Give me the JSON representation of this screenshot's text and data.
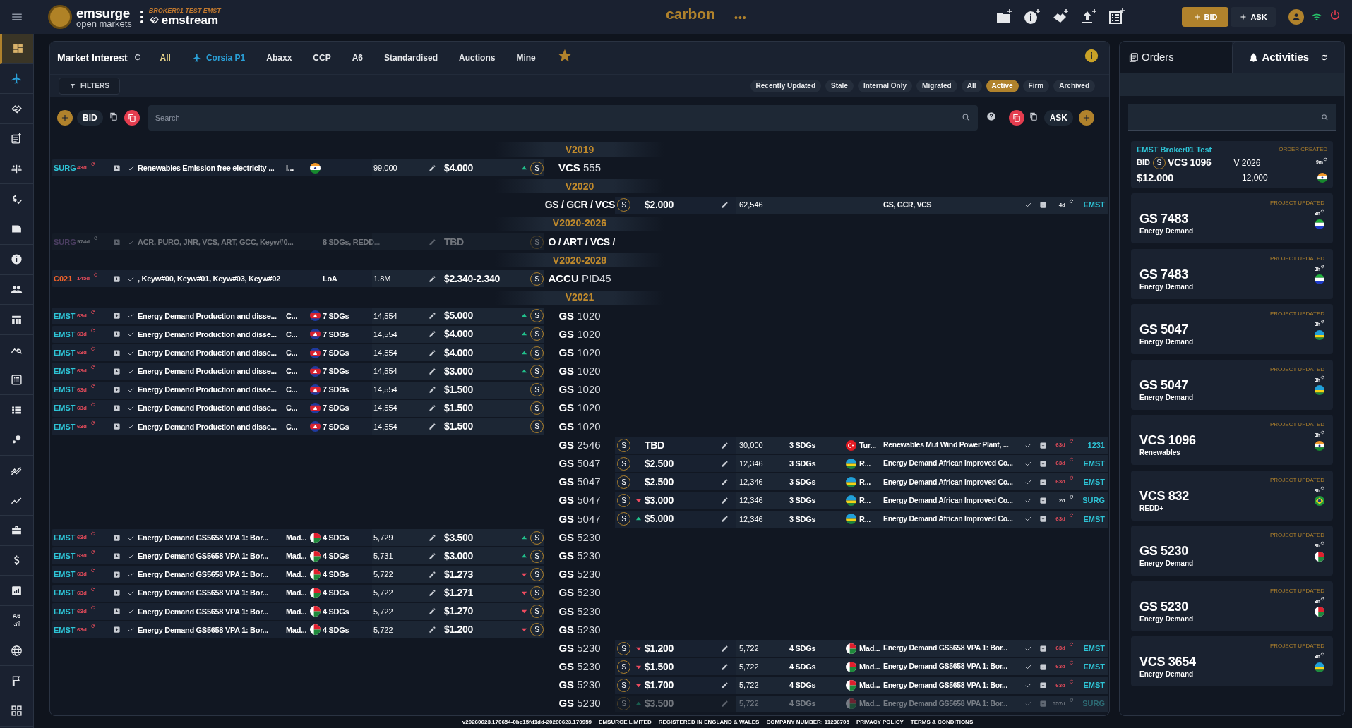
{
  "header": {
    "brand": "emsurge",
    "brand_sub": "open markets",
    "account": "BROKER01 TEST EMST",
    "product": "emstream",
    "market": "carbon",
    "more": "•••",
    "bid_button": "BID",
    "ask_button": "ASK"
  },
  "sidebar": {
    "items": [
      {
        "selected": true
      },
      {
        "selected": false
      },
      {
        "selected": false
      },
      {
        "selected": false
      },
      {
        "selected": false
      },
      {
        "selected": false
      },
      {
        "selected": false
      },
      {
        "selected": false
      },
      {
        "selected": false
      },
      {
        "selected": false
      },
      {
        "selected": false
      },
      {
        "selected": false
      },
      {
        "selected": false
      },
      {
        "selected": false
      },
      {
        "selected": false
      },
      {
        "selected": false
      },
      {
        "selected": false
      },
      {
        "selected": false
      },
      {
        "selected": false
      },
      {
        "selected": false,
        "label": "A6"
      },
      {
        "selected": false
      },
      {
        "selected": false
      },
      {
        "selected": false
      }
    ]
  },
  "market_interest": {
    "title": "Market Interest",
    "tabs": [
      {
        "label": "All",
        "selected": true,
        "kind": "plain"
      },
      {
        "label": "Corsia P1",
        "selected": false,
        "kind": "plane"
      },
      {
        "label": "Abaxx",
        "selected": false,
        "kind": "plain"
      },
      {
        "label": "CCP",
        "selected": false,
        "kind": "plain"
      },
      {
        "label": "A6",
        "selected": false,
        "kind": "plain"
      },
      {
        "label": "Standardised",
        "selected": false,
        "kind": "plain"
      },
      {
        "label": "Auctions",
        "selected": false,
        "kind": "plain"
      },
      {
        "label": "Mine",
        "selected": false,
        "kind": "plain"
      }
    ],
    "filters_button": "FILTERS",
    "status_filters": [
      {
        "label": "Recently Updated",
        "selected": false
      },
      {
        "label": "Stale",
        "selected": false
      },
      {
        "label": "Internal Only",
        "selected": false
      },
      {
        "label": "Migrated",
        "selected": false
      },
      {
        "label": "All",
        "selected": false
      },
      {
        "label": "Active",
        "selected": true
      },
      {
        "label": "Firm",
        "selected": false
      },
      {
        "label": "Archived",
        "selected": false
      }
    ],
    "bid_label": "BID",
    "ask_label": "ASK",
    "search": {
      "placeholder": "Search"
    }
  },
  "rows": [
    {
      "kind": "header",
      "label": "V2019"
    },
    {
      "kind": "order",
      "center": {
        "registry": "VCS",
        "number": "555"
      },
      "bid": {
        "broker": "SURG",
        "color": "#2ec4d6",
        "age": "43d",
        "stale": true,
        "disabled": false,
        "description": "Renewables Emission free electricity ...",
        "country": "I...",
        "flag": {
          "kind": "india"
        },
        "volume": "99,000",
        "price": "$4.000",
        "rising": true,
        "falling": false,
        "badge": "S"
      }
    },
    {
      "kind": "header",
      "label": "V2020"
    },
    {
      "kind": "order",
      "center": {
        "registry": "GS / GCR / VCS"
      },
      "ask": {
        "broker": "EMST",
        "color": "#2ec4d6",
        "age": "4d",
        "stale": false,
        "disabled": false,
        "description": "GS, GCR, VCS",
        "volume": "62,546",
        "price": "$2.000",
        "rising": false,
        "falling": false,
        "badge": "S"
      }
    },
    {
      "kind": "header",
      "label": "V2020-2026"
    },
    {
      "kind": "order",
      "center": {
        "registry": "O / ART / VCS /"
      },
      "bid": {
        "broker": "SURG",
        "color": "#4a3d60",
        "age": "974d",
        "stale": false,
        "disabled": true,
        "description": "ACR, PURO, JNR, VCS, ART, GCC, Keyw#0...",
        "sdgs": "8 SDGs, REDD...",
        "price": "TBD",
        "rising": false,
        "falling": false,
        "badge": "S"
      }
    },
    {
      "kind": "header",
      "label": "V2020-2028"
    },
    {
      "kind": "order",
      "center": {
        "registry": "ACCU",
        "number": "PID45"
      },
      "bid": {
        "broker": "C021",
        "color": "#f0622a",
        "age": "145d",
        "stale": true,
        "disabled": false,
        "description": ", Keyw#00, Keyw#01, Keyw#03, Keyw#02",
        "sdgs": "LoA",
        "volume": "1.8M",
        "price": "$2.340-2.340",
        "rising": false,
        "falling": false,
        "badge": "S"
      }
    },
    {
      "kind": "header",
      "label": "V2021"
    },
    {
      "kind": "order",
      "center": {
        "registry": "GS",
        "number": "1020"
      },
      "bid": {
        "broker": "EMST",
        "color": "#2ec4d6",
        "age": "63d",
        "stale": true,
        "disabled": false,
        "description": "Energy Demand Production and disse...",
        "country": "C...",
        "flag": {
          "kind": "cambodia"
        },
        "sdgs": "7 SDGs",
        "volume": "14,554",
        "price": "$5.000",
        "rising": true,
        "falling": false,
        "badge": "S"
      }
    },
    {
      "kind": "order",
      "center": {
        "registry": "GS",
        "number": "1020"
      },
      "bid": {
        "broker": "EMST",
        "color": "#2ec4d6",
        "age": "63d",
        "stale": true,
        "disabled": false,
        "description": "Energy Demand Production and disse...",
        "country": "C...",
        "flag": {
          "kind": "cambodia"
        },
        "sdgs": "7 SDGs",
        "volume": "14,554",
        "price": "$4.000",
        "rising": true,
        "falling": false,
        "badge": "S"
      }
    },
    {
      "kind": "order",
      "center": {
        "registry": "GS",
        "number": "1020"
      },
      "bid": {
        "broker": "EMST",
        "color": "#2ec4d6",
        "age": "63d",
        "stale": true,
        "disabled": false,
        "description": "Energy Demand Production and disse...",
        "country": "C...",
        "flag": {
          "kind": "cambodia"
        },
        "sdgs": "7 SDGs",
        "volume": "14,554",
        "price": "$4.000",
        "rising": true,
        "falling": false,
        "badge": "S"
      }
    },
    {
      "kind": "order",
      "center": {
        "registry": "GS",
        "number": "1020"
      },
      "bid": {
        "broker": "EMST",
        "color": "#2ec4d6",
        "age": "63d",
        "stale": true,
        "disabled": false,
        "description": "Energy Demand Production and disse...",
        "country": "C...",
        "flag": {
          "kind": "cambodia"
        },
        "sdgs": "7 SDGs",
        "volume": "14,554",
        "price": "$3.000",
        "rising": true,
        "falling": false,
        "badge": "S"
      }
    },
    {
      "kind": "order",
      "center": {
        "registry": "GS",
        "number": "1020"
      },
      "bid": {
        "broker": "EMST",
        "color": "#2ec4d6",
        "age": "63d",
        "stale": true,
        "disabled": false,
        "description": "Energy Demand Production and disse...",
        "country": "C...",
        "flag": {
          "kind": "cambodia"
        },
        "sdgs": "7 SDGs",
        "volume": "14,554",
        "price": "$1.500",
        "rising": false,
        "falling": false,
        "badge": "S"
      }
    },
    {
      "kind": "order",
      "center": {
        "registry": "GS",
        "number": "1020"
      },
      "bid": {
        "broker": "EMST",
        "color": "#2ec4d6",
        "age": "63d",
        "stale": true,
        "disabled": false,
        "description": "Energy Demand Production and disse...",
        "country": "C...",
        "flag": {
          "kind": "cambodia"
        },
        "sdgs": "7 SDGs",
        "volume": "14,554",
        "price": "$1.500",
        "rising": false,
        "falling": false,
        "badge": "S"
      }
    },
    {
      "kind": "order",
      "center": {
        "registry": "GS",
        "number": "1020"
      },
      "bid": {
        "broker": "EMST",
        "color": "#2ec4d6",
        "age": "63d",
        "stale": true,
        "disabled": false,
        "description": "Energy Demand Production and disse...",
        "country": "C...",
        "flag": {
          "kind": "cambodia"
        },
        "sdgs": "7 SDGs",
        "volume": "14,554",
        "price": "$1.500",
        "rising": false,
        "falling": false,
        "badge": "S"
      }
    },
    {
      "kind": "order",
      "center": {
        "registry": "GS",
        "number": "2546"
      },
      "ask": {
        "broker": "1231",
        "color": "#2ec4d6",
        "age": "63d",
        "stale": true,
        "disabled": false,
        "description": "Renewables Mut Wind Power Plant, ...",
        "country": "Tur...",
        "flag": {
          "kind": "turkey"
        },
        "sdgs": "3 SDGs",
        "volume": "30,000",
        "price": "TBD",
        "rising": false,
        "falling": false,
        "badge": "S"
      }
    },
    {
      "kind": "order",
      "center": {
        "registry": "GS",
        "number": "5047"
      },
      "ask": {
        "broker": "EMST",
        "color": "#2ec4d6",
        "age": "63d",
        "stale": true,
        "disabled": false,
        "description": "Energy Demand African Improved Co...",
        "country": "R...",
        "flag": {
          "kind": "rwanda"
        },
        "sdgs": "3 SDGs",
        "volume": "12,346",
        "price": "$2.500",
        "rising": false,
        "falling": false,
        "badge": "S"
      }
    },
    {
      "kind": "order",
      "center": {
        "registry": "GS",
        "number": "5047"
      },
      "ask": {
        "broker": "EMST",
        "color": "#2ec4d6",
        "age": "63d",
        "stale": true,
        "disabled": false,
        "description": "Energy Demand African Improved Co...",
        "country": "R...",
        "flag": {
          "kind": "rwanda"
        },
        "sdgs": "3 SDGs",
        "volume": "12,346",
        "price": "$2.500",
        "rising": false,
        "falling": false,
        "badge": "S"
      }
    },
    {
      "kind": "order",
      "center": {
        "registry": "GS",
        "number": "5047"
      },
      "ask": {
        "broker": "SURG",
        "color": "#2ec4d6",
        "age": "2d",
        "stale": false,
        "disabled": false,
        "description": "Energy Demand African Improved Co...",
        "country": "R...",
        "flag": {
          "kind": "rwanda"
        },
        "sdgs": "3 SDGs",
        "volume": "12,346",
        "price": "$3.000",
        "rising": false,
        "falling": true,
        "badge": "S"
      }
    },
    {
      "kind": "order",
      "center": {
        "registry": "GS",
        "number": "5047"
      },
      "ask": {
        "broker": "EMST",
        "color": "#2ec4d6",
        "age": "63d",
        "stale": true,
        "disabled": false,
        "description": "Energy Demand African Improved Co...",
        "country": "R...",
        "flag": {
          "kind": "rwanda"
        },
        "sdgs": "3 SDGs",
        "volume": "12,346",
        "price": "$5.000",
        "rising": true,
        "falling": false,
        "badge": "S"
      }
    },
    {
      "kind": "order",
      "center": {
        "registry": "GS",
        "number": "5230"
      },
      "bid": {
        "broker": "EMST",
        "color": "#2ec4d6",
        "age": "63d",
        "stale": true,
        "disabled": false,
        "description": "Energy Demand GS5658 VPA 1: Bor...",
        "country": "Mad...",
        "flag": {
          "kind": "madagascar"
        },
        "sdgs": "4 SDGs",
        "volume": "5,729",
        "price": "$3.500",
        "rising": true,
        "falling": false,
        "badge": "S"
      }
    },
    {
      "kind": "order",
      "center": {
        "registry": "GS",
        "number": "5230"
      },
      "bid": {
        "broker": "EMST",
        "color": "#2ec4d6",
        "age": "63d",
        "stale": true,
        "disabled": false,
        "description": "Energy Demand GS5658 VPA 1: Bor...",
        "country": "Mad...",
        "flag": {
          "kind": "madagascar"
        },
        "sdgs": "4 SDGs",
        "volume": "5,731",
        "price": "$3.000",
        "rising": true,
        "falling": false,
        "badge": "S"
      }
    },
    {
      "kind": "order",
      "center": {
        "registry": "GS",
        "number": "5230"
      },
      "bid": {
        "broker": "EMST",
        "color": "#2ec4d6",
        "age": "63d",
        "stale": true,
        "disabled": false,
        "description": "Energy Demand GS5658 VPA 1: Bor...",
        "country": "Mad...",
        "flag": {
          "kind": "madagascar"
        },
        "sdgs": "4 SDGs",
        "volume": "5,722",
        "price": "$1.273",
        "rising": false,
        "falling": true,
        "badge": "S"
      }
    },
    {
      "kind": "order",
      "center": {
        "registry": "GS",
        "number": "5230"
      },
      "bid": {
        "broker": "EMST",
        "color": "#2ec4d6",
        "age": "63d",
        "stale": true,
        "disabled": false,
        "description": "Energy Demand GS5658 VPA 1: Bor...",
        "country": "Mad...",
        "flag": {
          "kind": "madagascar"
        },
        "sdgs": "4 SDGs",
        "volume": "5,722",
        "price": "$1.271",
        "rising": false,
        "falling": true,
        "badge": "S"
      }
    },
    {
      "kind": "order",
      "center": {
        "registry": "GS",
        "number": "5230"
      },
      "bid": {
        "broker": "EMST",
        "color": "#2ec4d6",
        "age": "63d",
        "stale": true,
        "disabled": false,
        "description": "Energy Demand GS5658 VPA 1: Bor...",
        "country": "Mad...",
        "flag": {
          "kind": "madagascar"
        },
        "sdgs": "4 SDGs",
        "volume": "5,722",
        "price": "$1.270",
        "rising": false,
        "falling": true,
        "badge": "S"
      }
    },
    {
      "kind": "order",
      "center": {
        "registry": "GS",
        "number": "5230"
      },
      "bid": {
        "broker": "EMST",
        "color": "#2ec4d6",
        "age": "63d",
        "stale": true,
        "disabled": false,
        "description": "Energy Demand GS5658 VPA 1: Bor...",
        "country": "Mad...",
        "flag": {
          "kind": "madagascar"
        },
        "sdgs": "4 SDGs",
        "volume": "5,722",
        "price": "$1.200",
        "rising": false,
        "falling": true,
        "badge": "S"
      }
    },
    {
      "kind": "order",
      "center": {
        "registry": "GS",
        "number": "5230"
      },
      "ask": {
        "broker": "EMST",
        "color": "#2ec4d6",
        "age": "63d",
        "stale": true,
        "disabled": false,
        "description": "Energy Demand GS5658 VPA 1: Bor...",
        "country": "Mad...",
        "flag": {
          "kind": "madagascar"
        },
        "sdgs": "4 SDGs",
        "volume": "5,722",
        "price": "$1.200",
        "rising": false,
        "falling": true,
        "badge": "S"
      }
    },
    {
      "kind": "order",
      "center": {
        "registry": "GS",
        "number": "5230"
      },
      "ask": {
        "broker": "EMST",
        "color": "#2ec4d6",
        "age": "63d",
        "stale": true,
        "disabled": false,
        "description": "Energy Demand GS5658 VPA 1: Bor...",
        "country": "Mad...",
        "flag": {
          "kind": "madagascar"
        },
        "sdgs": "4 SDGs",
        "volume": "5,722",
        "price": "$1.500",
        "rising": false,
        "falling": true,
        "badge": "S"
      }
    },
    {
      "kind": "order",
      "center": {
        "registry": "GS",
        "number": "5230"
      },
      "ask": {
        "broker": "EMST",
        "color": "#2ec4d6",
        "age": "63d",
        "stale": true,
        "disabled": false,
        "description": "Energy Demand GS5658 VPA 1: Bor...",
        "country": "Mad...",
        "flag": {
          "kind": "madagascar"
        },
        "sdgs": "4 SDGs",
        "volume": "5,722",
        "price": "$1.700",
        "rising": false,
        "falling": true,
        "badge": "S"
      }
    },
    {
      "kind": "order",
      "center": {
        "registry": "GS",
        "number": "5230"
      },
      "ask": {
        "broker": "SURG",
        "color": "#2d6b74",
        "age": "557d",
        "stale": false,
        "disabled": true,
        "description": "Energy Demand GS5658 VPA 1: Bor...",
        "country": "Mad...",
        "flag": {
          "kind": "madagascar"
        },
        "sdgs": "4 SDGs",
        "volume": "5,722",
        "price": "$3.500",
        "rising": true,
        "falling": false,
        "badge": "S"
      }
    }
  ],
  "activity_panel": {
    "tabs": [
      {
        "label": "Orders",
        "selected": false
      },
      {
        "label": "Activities",
        "selected": true
      }
    ],
    "cards": [
      {
        "kind": "order",
        "broker": "EMST Broker01 Test",
        "event": "ORDER CREATED",
        "side": "BID",
        "badge": "S",
        "title": "VCS 1096",
        "vintage": "V 2026",
        "age": "9m",
        "price": "$12.000",
        "volume": "12,000",
        "flag": {
          "kind": "india"
        }
      },
      {
        "kind": "project",
        "event": "PROJECT UPDATED",
        "title": "GS 7483",
        "subtitle": "Energy Demand",
        "age": "3h",
        "flag": {
          "kind": "sierraleone"
        }
      },
      {
        "kind": "project",
        "event": "PROJECT UPDATED",
        "title": "GS 7483",
        "subtitle": "Energy Demand",
        "age": "3h",
        "flag": {
          "kind": "sierraleone"
        }
      },
      {
        "kind": "project",
        "event": "PROJECT UPDATED",
        "title": "GS 5047",
        "subtitle": "Energy Demand",
        "age": "3h",
        "flag": {
          "kind": "rwanda"
        }
      },
      {
        "kind": "project",
        "event": "PROJECT UPDATED",
        "title": "GS 5047",
        "subtitle": "Energy Demand",
        "age": "3h",
        "flag": {
          "kind": "rwanda"
        }
      },
      {
        "kind": "project",
        "event": "PROJECT UPDATED",
        "title": "VCS 1096",
        "subtitle": "Renewables",
        "age": "3h",
        "flag": {
          "kind": "india"
        }
      },
      {
        "kind": "project",
        "event": "PROJECT UPDATED",
        "title": "VCS 832",
        "subtitle": "REDD+",
        "age": "3h",
        "flag": {
          "kind": "brazil"
        }
      },
      {
        "kind": "project",
        "event": "PROJECT UPDATED",
        "title": "GS 5230",
        "subtitle": "Energy Demand",
        "age": "3h",
        "flag": {
          "kind": "madagascar"
        }
      },
      {
        "kind": "project",
        "event": "PROJECT UPDATED",
        "title": "GS 5230",
        "subtitle": "Energy Demand",
        "age": "3h",
        "flag": {
          "kind": "madagascar"
        }
      },
      {
        "kind": "project",
        "event": "PROJECT UPDATED",
        "title": "VCS 3654",
        "subtitle": "Energy Demand",
        "age": "3h",
        "flag": {
          "kind": "rwanda"
        }
      }
    ]
  },
  "footer": [
    "v20260623.170654-0be15fd1dd-20260623.170959",
    "EMSURGE LIMITED",
    "REGISTERED IN ENGLAND & WALES",
    "COMPANY NUMBER: 11236705",
    "PRIVACY POLICY",
    "TERMS & CONDITIONS"
  ]
}
